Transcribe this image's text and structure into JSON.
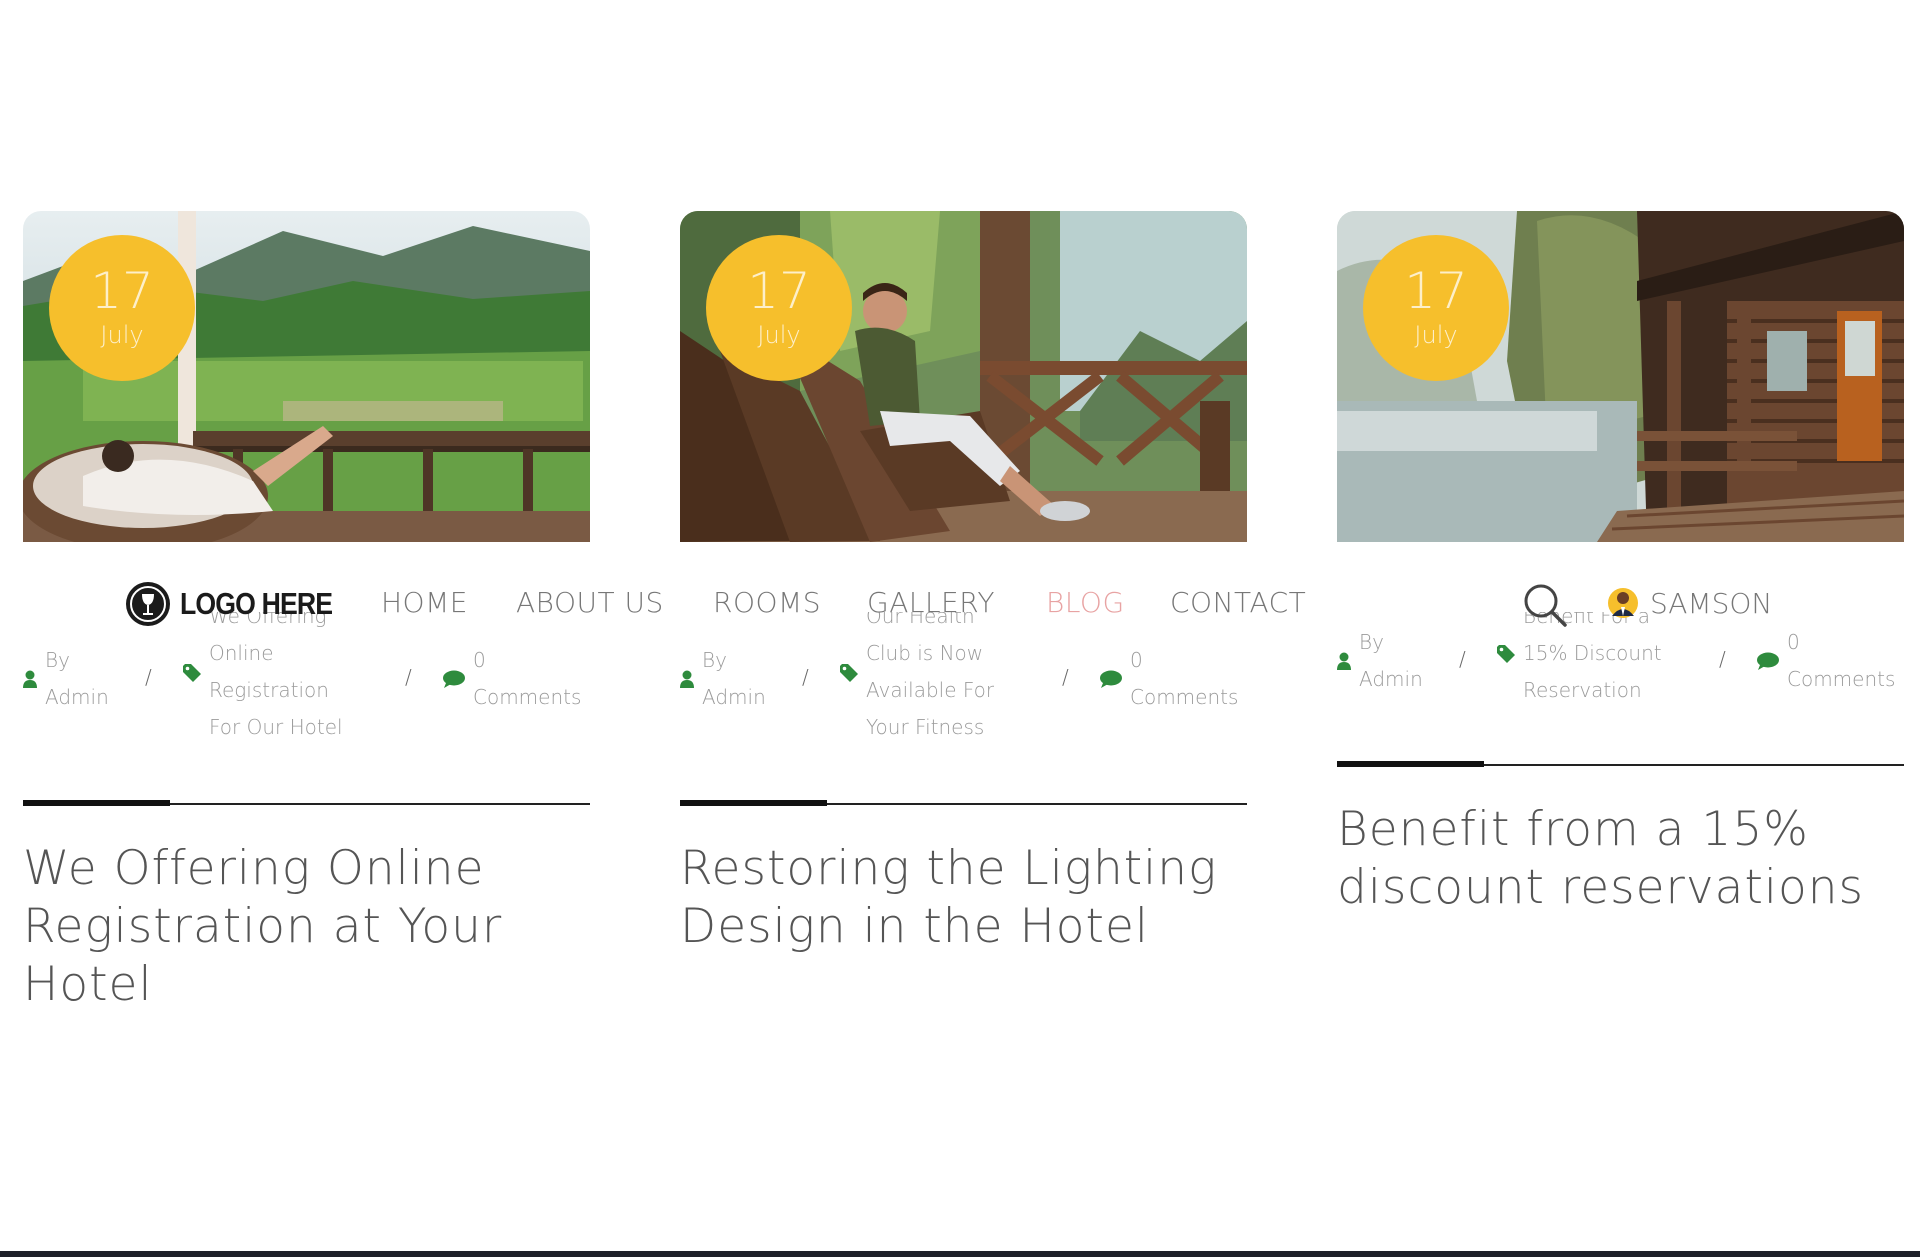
{
  "nav": {
    "logo_text": "LOGO HERE",
    "items": [
      {
        "label": "HOME",
        "active": false
      },
      {
        "label": "ABOUT US",
        "active": false
      },
      {
        "label": "ROOMS",
        "active": false
      },
      {
        "label": "GALLERY",
        "active": false
      },
      {
        "label": "BLOG",
        "active": true
      },
      {
        "label": "CONTACT",
        "active": false
      }
    ],
    "search_icon": "search-icon",
    "user_name": "SAMSON"
  },
  "colors": {
    "badge": "#f6bf2c",
    "meta_icon": "#2e8b3d",
    "active_nav": "#e8a3a3",
    "text": "#555555"
  },
  "posts": [
    {
      "date_day": "17",
      "date_month": "July",
      "author_prefix": "By",
      "author": "Admin",
      "separator": "/",
      "tag_lines": [
        "We Offering",
        "Online",
        "Registration",
        "For Our Hotel"
      ],
      "comments_count": "0",
      "comments_label": "Comments",
      "title": "We Offering Online Registration at Your Hotel"
    },
    {
      "date_day": "17",
      "date_month": "July",
      "author_prefix": "By",
      "author": "Admin",
      "separator": "/",
      "tag_lines": [
        "Our Health",
        "Club is Now",
        "Available For",
        "Your Fitness"
      ],
      "comments_count": "0",
      "comments_label": "Comments",
      "title": "Restoring the Lighting Design in the Hotel"
    },
    {
      "date_day": "17",
      "date_month": "July",
      "author_prefix": "By",
      "author": "Admin",
      "separator": "/",
      "tag_lines": [
        "Benefit For a",
        "15% Discount",
        "Reservation"
      ],
      "comments_count": "0",
      "comments_label": "Comments",
      "title": "Benefit from a 15% discount reservations"
    }
  ]
}
